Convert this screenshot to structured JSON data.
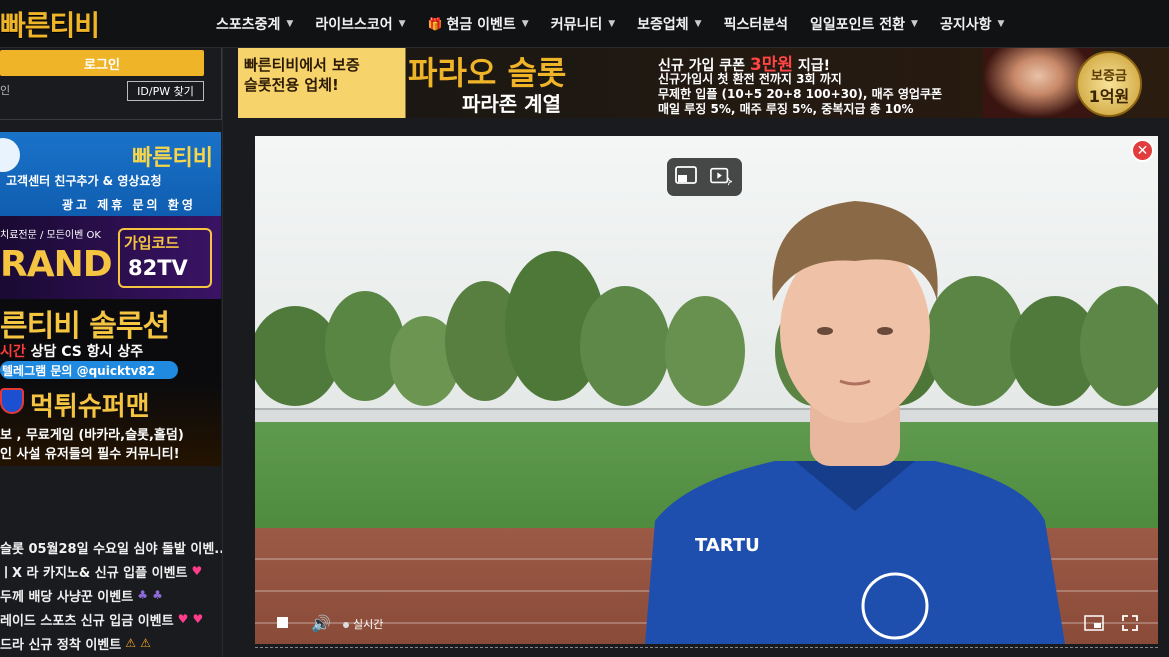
{
  "header": {
    "logo": "빠른티비",
    "nav": [
      {
        "label": "스포츠중계",
        "has_dropdown": true
      },
      {
        "label": "라이브스코어",
        "has_dropdown": true
      },
      {
        "label": "현금 이벤트",
        "has_dropdown": true,
        "icon": "gift-icon"
      },
      {
        "label": "커뮤니티",
        "has_dropdown": true
      },
      {
        "label": "보증업체",
        "has_dropdown": true
      },
      {
        "label": "픽스터분석",
        "has_dropdown": false
      },
      {
        "label": "일일포인트 전환",
        "has_dropdown": true
      },
      {
        "label": "공지사항",
        "has_dropdown": true
      }
    ]
  },
  "sidebar": {
    "login_label": "로그인",
    "member_text": "인",
    "idpw_label": "ID/PW 찾기",
    "banners": {
      "b1": {
        "title": "빠른티비",
        "line1": "고객센터 친구추가 & 영상요청",
        "line2": "광고 제휴 문의 환영"
      },
      "b2": {
        "line1": "치료전문 / 모든이벤 OK",
        "brand": "RAND",
        "code_label": "가입코드",
        "code": "82TV"
      },
      "b3": {
        "title": "른티비 솔루션",
        "line1_red": "시간",
        "line1": " 상담 CS 항시 상주",
        "line2": "텔레그램 문의 @quicktv82"
      },
      "b4": {
        "title": "먹튀슈퍼맨",
        "line1": "보 , 무료게임 (바카라,슬롯,홀덤)",
        "line2": "인 사설 유저들의 필수 커뮤니티!"
      }
    },
    "posts": [
      {
        "text": "슬롯 05월28일 수요일 심야 돌발 이벤...",
        "emoji": ""
      },
      {
        "text": "ㅣX 라 카지노& 신규 입플 이벤트",
        "emoji": "♥"
      },
      {
        "text": "두께 배당 사냥꾼 이벤트",
        "emoji": "♣ ♣"
      },
      {
        "text": "레이드 스포츠 신규 입금 이벤트",
        "emoji": "♥ ♥"
      },
      {
        "text": "드라 신규 정착 이벤트",
        "emoji": "⚠ ⚠"
      }
    ]
  },
  "top_banner": {
    "left_line1": "빠른티비에서 보증",
    "left_line2": "슬롯전용 업체!",
    "brand": "파라오 슬롯",
    "brand_sub": "파라존 계열",
    "r1_a": "신규 가입 쿠폰 ",
    "r1_b": "3만원",
    "r1_c": " 지급!",
    "r2": "신규가입시 첫 환전 전까지 3회 까지",
    "r3": "무제한 입플 (10+5 20+8 100+30), 매주 영업쿠폰",
    "r4": "매일 루징 5%, 매주 루징 5%, 중복지급 총 10%",
    "seal_top": "보증금",
    "seal_bottom": "1억원"
  },
  "player": {
    "live_label": "실시간",
    "jersey_text": "TARTU",
    "close_label": "✕"
  },
  "colors": {
    "accent": "#f0b429",
    "background": "#1a1b1f",
    "close_red": "#e23c3c"
  }
}
